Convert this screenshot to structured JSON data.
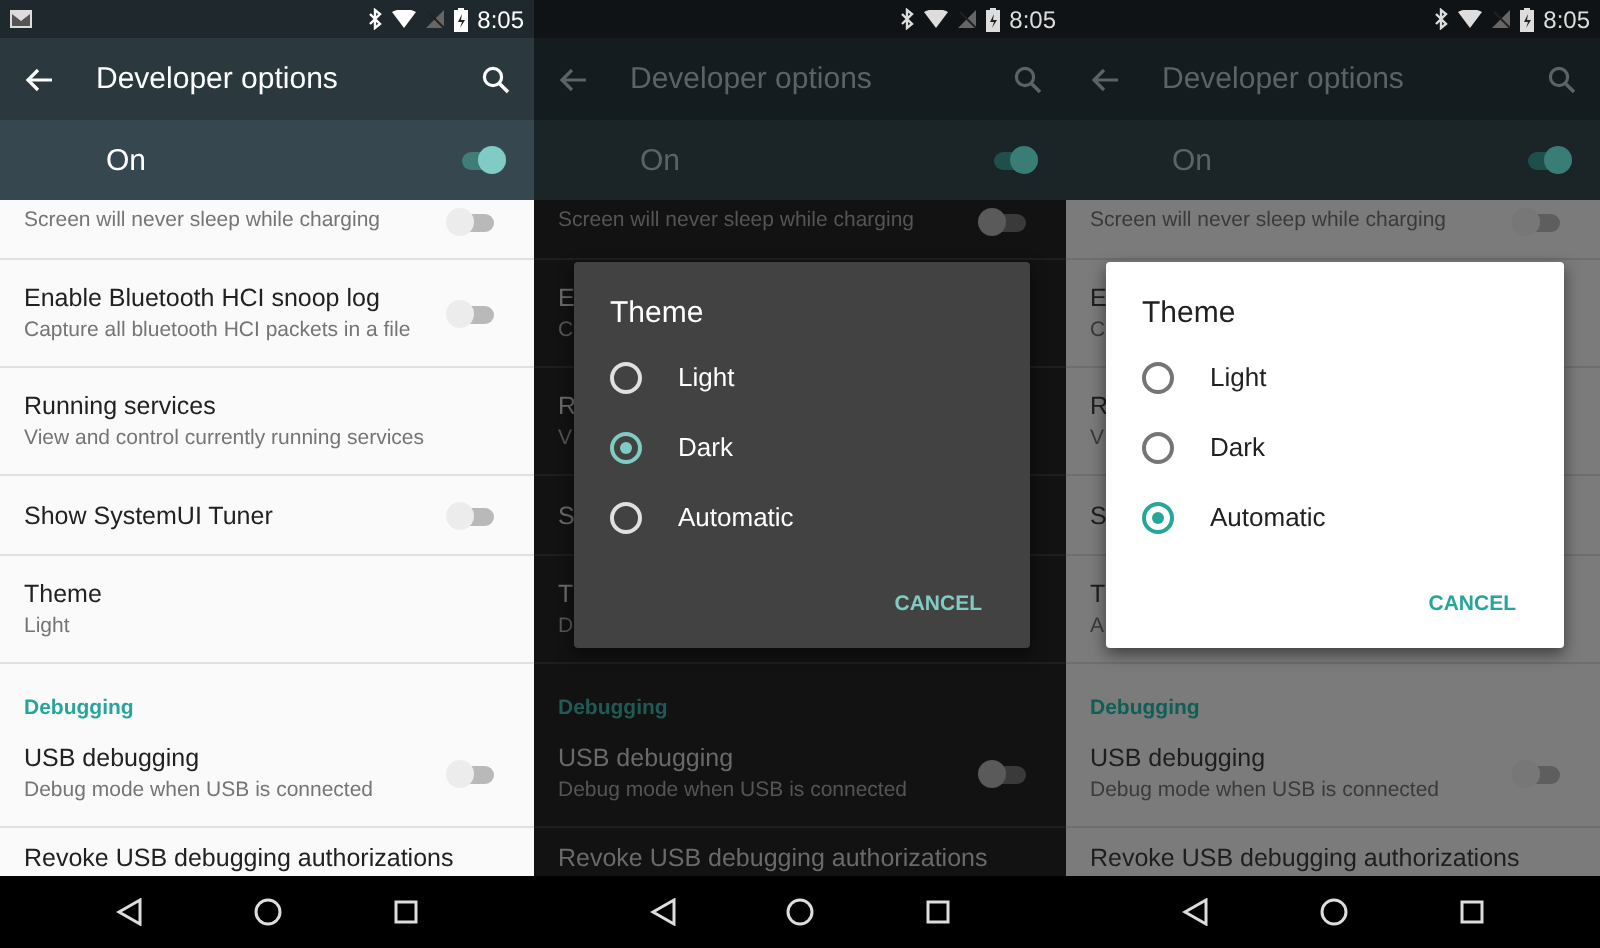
{
  "panels": [
    {
      "dark": false,
      "dimmed": false,
      "status_bar": {
        "mail_notification": true,
        "time": "8:05"
      },
      "toolbar": {
        "title": "Developer options"
      },
      "master_switch": {
        "label": "On",
        "on": true
      },
      "settings": [
        {
          "kind": "partial",
          "subtitle": "Screen will never sleep while charging",
          "switch": {
            "on": false
          }
        },
        {
          "kind": "item",
          "title": "Enable Bluetooth HCI snoop log",
          "subtitle": "Capture all bluetooth HCI packets in a file",
          "switch": {
            "on": false
          }
        },
        {
          "kind": "item",
          "title": "Running services",
          "subtitle": "View and control currently running services"
        },
        {
          "kind": "item",
          "title": "Show SystemUI Tuner",
          "switch": {
            "on": false
          }
        },
        {
          "kind": "item",
          "title": "Theme",
          "subtitle": "Light"
        },
        {
          "kind": "header",
          "title": "Debugging"
        },
        {
          "kind": "item",
          "title": "USB debugging",
          "subtitle": "Debug mode when USB is connected",
          "switch": {
            "on": false
          }
        },
        {
          "kind": "last",
          "title": "Revoke USB debugging authorizations"
        }
      ]
    },
    {
      "dark": true,
      "dimmed": true,
      "status_bar": {
        "mail_notification": false,
        "time": "8:05"
      },
      "toolbar": {
        "title": "Developer options"
      },
      "master_switch": {
        "label": "On",
        "on": true
      },
      "settings": [
        {
          "kind": "partial",
          "subtitle": "Screen will never sleep while charging",
          "switch": {
            "on": false
          }
        },
        {
          "kind": "item",
          "title": "E",
          "subtitle": "C"
        },
        {
          "kind": "item",
          "title": "R",
          "subtitle": "V"
        },
        {
          "kind": "item",
          "title": "S"
        },
        {
          "kind": "item",
          "title": "T",
          "subtitle": "D"
        },
        {
          "kind": "header",
          "title": "Debugging"
        },
        {
          "kind": "item",
          "title": "USB debugging",
          "subtitle": "Debug mode when USB is connected",
          "switch": {
            "on": false
          }
        },
        {
          "kind": "last",
          "title": "Revoke USB debugging authorizations"
        }
      ],
      "dialog": {
        "title": "Theme",
        "options": [
          {
            "label": "Light",
            "selected": false
          },
          {
            "label": "Dark",
            "selected": true
          },
          {
            "label": "Automatic",
            "selected": false
          }
        ],
        "button": "CANCEL"
      }
    },
    {
      "dark": false,
      "dimmed": true,
      "status_bar": {
        "mail_notification": false,
        "time": "8:05"
      },
      "toolbar": {
        "title": "Developer options"
      },
      "master_switch": {
        "label": "On",
        "on": true
      },
      "settings": [
        {
          "kind": "partial",
          "subtitle": "Screen will never sleep while charging",
          "switch": {
            "on": false
          }
        },
        {
          "kind": "item",
          "title": "E",
          "subtitle": "C"
        },
        {
          "kind": "item",
          "title": "R",
          "subtitle": "V"
        },
        {
          "kind": "item",
          "title": "S"
        },
        {
          "kind": "item",
          "title": "T",
          "subtitle": "A"
        },
        {
          "kind": "header",
          "title": "Debugging"
        },
        {
          "kind": "item",
          "title": "USB debugging",
          "subtitle": "Debug mode when USB is connected",
          "switch": {
            "on": false
          }
        },
        {
          "kind": "last",
          "title": "Revoke USB debugging authorizations"
        }
      ],
      "dialog": {
        "title": "Theme",
        "options": [
          {
            "label": "Light",
            "selected": false
          },
          {
            "label": "Dark",
            "selected": false
          },
          {
            "label": "Automatic",
            "selected": true
          }
        ],
        "button": "CANCEL"
      }
    }
  ]
}
